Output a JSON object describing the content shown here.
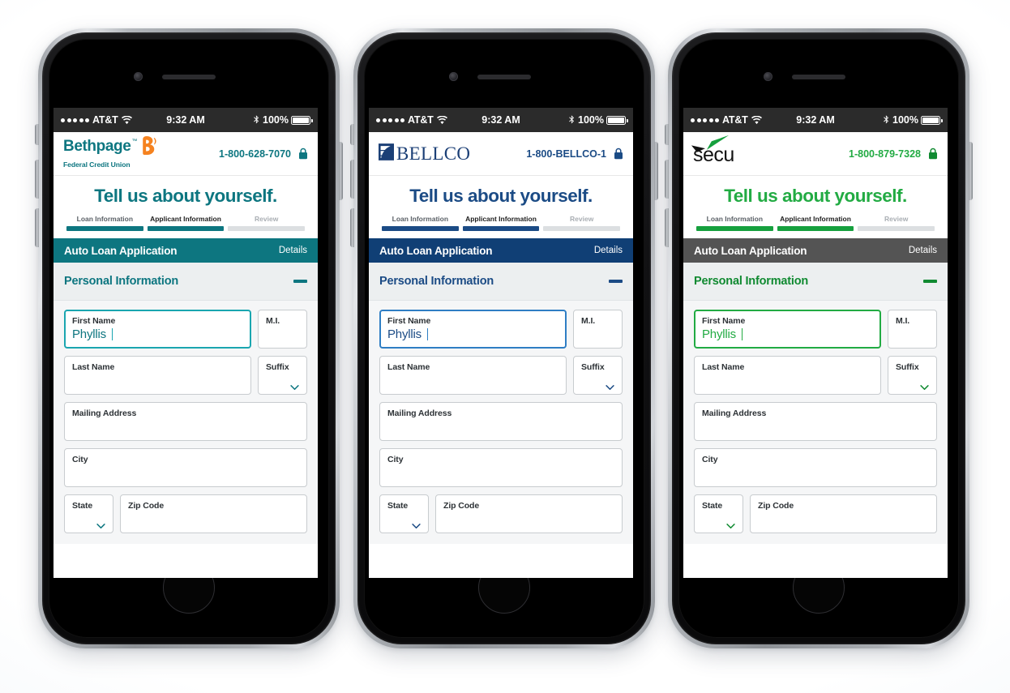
{
  "background": {
    "color": "#ffffff"
  },
  "status_bar": {
    "signal_dots": 5,
    "carrier": "AT&T",
    "wifi_icon": "wifi-icon",
    "time": "9:32 AM",
    "bluetooth_icon": "bluetooth-icon",
    "battery_percent": "100%",
    "battery_icon": "battery-full-icon"
  },
  "common": {
    "hero_title": "Tell us about yourself.",
    "steps": [
      {
        "label": "Loan Information",
        "state": "done"
      },
      {
        "label": "Applicant Information",
        "state": "active"
      },
      {
        "label": "Review",
        "state": "todo"
      }
    ],
    "appbar": {
      "title": "Auto Loan Application",
      "action": "Details"
    },
    "section": {
      "title": "Personal Information",
      "collapse_icon": "minus-icon"
    },
    "lock_icon": "lock-icon",
    "fields": {
      "first_name": {
        "label": "First Name",
        "value": "Phyllis"
      },
      "middle_initial": {
        "label": "M.I.",
        "value": ""
      },
      "last_name": {
        "label": "Last Name",
        "value": ""
      },
      "suffix": {
        "label": "Suffix",
        "value": "",
        "icon": "chevron-down-icon"
      },
      "mailing_address": {
        "label": "Mailing Address",
        "value": ""
      },
      "city": {
        "label": "City",
        "value": ""
      },
      "state": {
        "label": "State",
        "value": "",
        "icon": "chevron-down-icon"
      },
      "zip_code": {
        "label": "Zip Code",
        "value": ""
      }
    }
  },
  "phones": [
    {
      "id": "bethpage",
      "brand": {
        "name": "Bethpage",
        "tagline": "Federal Credit Union",
        "tm": "™",
        "logo_icon": "bethpage-b-swirl-icon"
      },
      "phone_number": "1-800-628-7070",
      "accent": "#0d7680",
      "appbar_bg": "#0d7680",
      "title_color": "#0d7680",
      "section_title_color": "#0d7680",
      "focus_border": "#1aa6b0",
      "value_color": "#0d7680",
      "chevron_color": "#0d7680"
    },
    {
      "id": "bellco",
      "brand": {
        "name": "BELLCO",
        "tagline": "",
        "logo_icon": "bellco-b-mark-icon"
      },
      "phone_number": "1-800-BELLCO-1",
      "accent": "#1b4b85",
      "appbar_bg": "#103f75",
      "title_color": "#1b4b85",
      "section_title_color": "#1b4b85",
      "focus_border": "#2f7ec4",
      "value_color": "#1b4b85",
      "chevron_color": "#1b4b85"
    },
    {
      "id": "secu",
      "brand": {
        "name": "secu",
        "tagline": "",
        "logo_icon": "secu-swoosh-icon"
      },
      "phone_number": "1-800-879-7328",
      "accent": "#16a03e",
      "appbar_bg": "#545454",
      "title_color": "#22ab43",
      "section_title_color": "#108a31",
      "focus_border": "#22ab43",
      "value_color": "#22ab43",
      "chevron_color": "#108a31"
    }
  ]
}
